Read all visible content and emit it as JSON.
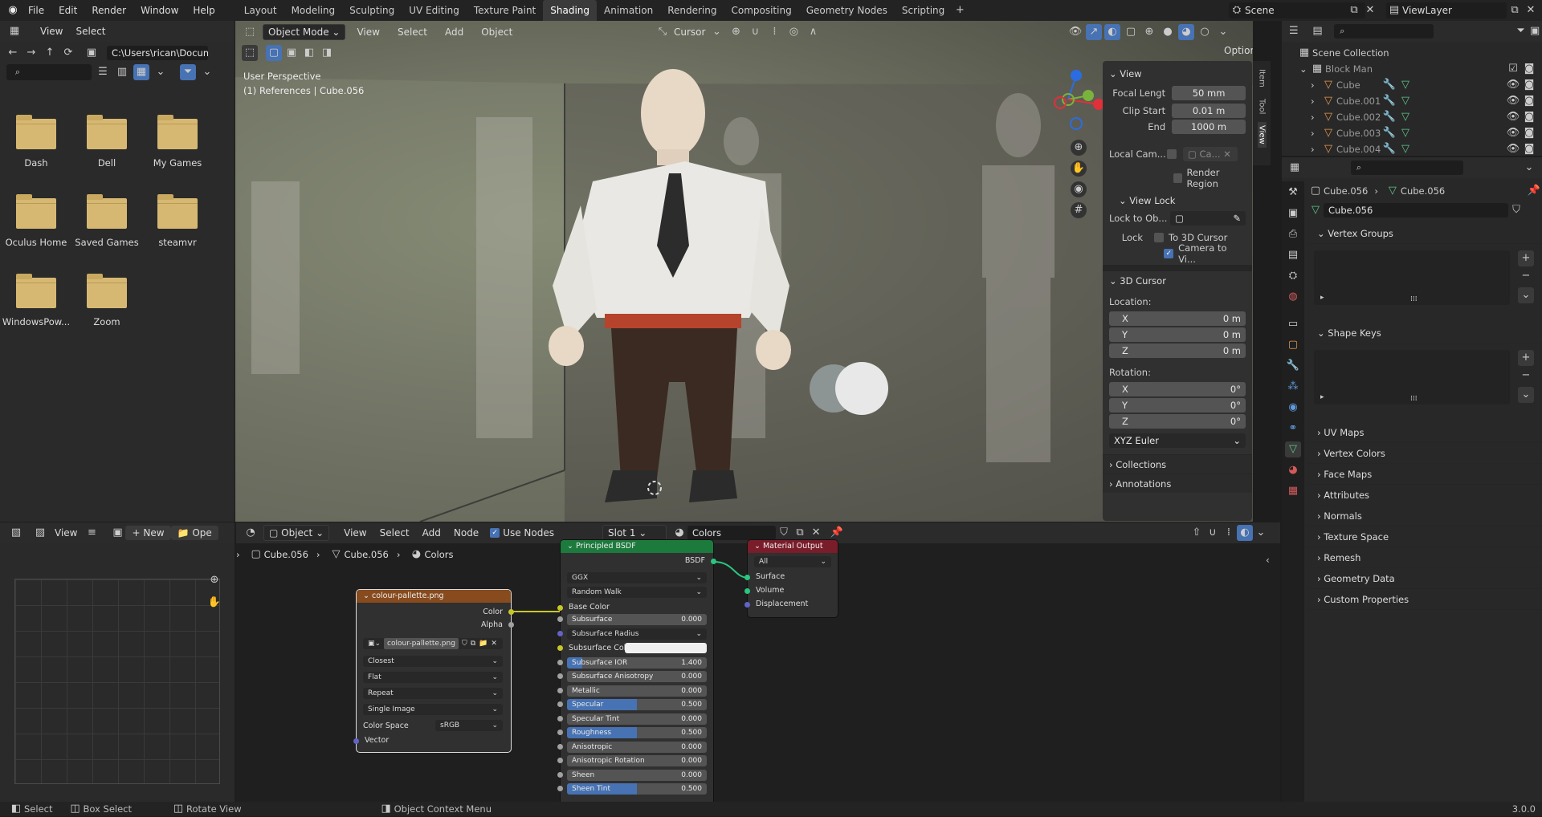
{
  "menubar": {
    "file": "File",
    "edit": "Edit",
    "render": "Render",
    "window": "Window",
    "help": "Help"
  },
  "workspaces": [
    "Layout",
    "Modeling",
    "Sculpting",
    "UV Editing",
    "Texture Paint",
    "Shading",
    "Animation",
    "Rendering",
    "Compositing",
    "Geometry Nodes",
    "Scripting"
  ],
  "scene": {
    "name": "Scene",
    "view_layer": "ViewLayer"
  },
  "file_browser": {
    "view": "View",
    "select": "Select",
    "path": "C:\\Users\\rican\\Docum...",
    "folders": [
      "Dash",
      "Dell",
      "My Games",
      "Oculus Home",
      "Saved Games",
      "steamvr",
      "WindowsPow...",
      "Zoom"
    ]
  },
  "viewport": {
    "mode": "Object Mode",
    "view": "View",
    "select": "Select",
    "add": "Add",
    "object": "Object",
    "pivot": "Cursor",
    "options": "Options",
    "perspective": "User Perspective",
    "collection_info": "(1) References | Cube.056"
  },
  "npanel": {
    "tabs": [
      "Item",
      "Tool",
      "View"
    ],
    "view_header": "View",
    "focal_label": "Focal Lengt",
    "focal": "50 mm",
    "clip_start_label": "Clip Start",
    "clip_start": "0.01 m",
    "end_label": "End",
    "end": "1000 m",
    "local_cam": "Local Cam...",
    "local_cam_val": "Ca...",
    "render_region": "Render Region",
    "view_lock": "View Lock",
    "lock_to_ob": "Lock to Ob...",
    "lock": "Lock",
    "to_3d_cursor": "To 3D Cursor",
    "camera_to_view": "Camera to Vi...",
    "cursor_header": "3D Cursor",
    "location": "Location:",
    "loc": [
      {
        "axis": "X",
        "val": "0 m"
      },
      {
        "axis": "Y",
        "val": "0 m"
      },
      {
        "axis": "Z",
        "val": "0 m"
      }
    ],
    "rotation": "Rotation:",
    "rot": [
      {
        "axis": "X",
        "val": "0°"
      },
      {
        "axis": "Y",
        "val": "0°"
      },
      {
        "axis": "Z",
        "val": "0°"
      }
    ],
    "rot_mode": "XYZ Euler",
    "collections": "Collections",
    "annotations": "Annotations"
  },
  "outliner": {
    "root": "Scene Collection",
    "collection": "Block Man",
    "objects": [
      "Cube",
      "Cube.001",
      "Cube.002",
      "Cube.003",
      "Cube.004"
    ]
  },
  "properties": {
    "breadcrumb_obj": "Cube.056",
    "breadcrumb_mesh": "Cube.056",
    "mesh_name": "Cube.056",
    "vertex_groups": "Vertex Groups",
    "shape_keys": "Shape Keys",
    "sections": [
      "UV Maps",
      "Vertex Colors",
      "Face Maps",
      "Attributes",
      "Normals",
      "Texture Space",
      "Remesh",
      "Geometry Data",
      "Custom Properties"
    ]
  },
  "image_editor": {
    "view": "View",
    "new": "New",
    "open": "Ope"
  },
  "node_editor": {
    "object": "Object",
    "view": "View",
    "select": "Select",
    "add": "Add",
    "node": "Node",
    "use_nodes": "Use Nodes",
    "slot": "Slot 1",
    "material": "Colors",
    "bc_obj": "Cube.056",
    "bc_mesh": "Cube.056",
    "bc_mat": "Colors"
  },
  "image_node": {
    "title": "colour-pallette.png",
    "color": "Color",
    "alpha": "Alpha",
    "image": "colour-pallette.png",
    "interp": "Closest",
    "proj": "Flat",
    "ext": "Repeat",
    "source": "Single Image",
    "cs_label": "Color Space",
    "cs": "sRGB",
    "vector": "Vector"
  },
  "bsdf_node": {
    "title": "Principled BSDF",
    "out": "BSDF",
    "dist": "GGX",
    "sss_method": "Random Walk",
    "base_color": "Base Color",
    "rows": [
      {
        "label": "Subsurface",
        "val": "0.000",
        "fill": 0
      },
      {
        "label": "Subsurface IOR",
        "val": "1.400",
        "fill": 0.11
      },
      {
        "label": "Subsurface Anisotropy",
        "val": "0.000",
        "fill": 0
      },
      {
        "label": "Metallic",
        "val": "0.000",
        "fill": 0
      },
      {
        "label": "Specular",
        "val": "0.500",
        "fill": 0.5
      },
      {
        "label": "Specular Tint",
        "val": "0.000",
        "fill": 0
      },
      {
        "label": "Roughness",
        "val": "0.500",
        "fill": 0.5
      },
      {
        "label": "Anisotropic",
        "val": "0.000",
        "fill": 0
      },
      {
        "label": "Anisotropic Rotation",
        "val": "0.000",
        "fill": 0
      },
      {
        "label": "Sheen",
        "val": "0.000",
        "fill": 0
      },
      {
        "label": "Sheen Tint",
        "val": "0.500",
        "fill": 0.5
      }
    ],
    "sss_radius": "Subsurface Radius",
    "sss_color": "Subsurface Colo"
  },
  "output_node": {
    "title": "Material Output",
    "target": "All",
    "surface": "Surface",
    "volume": "Volume",
    "displacement": "Displacement"
  },
  "statusbar": {
    "select": "Select",
    "box_select": "Box Select",
    "rotate": "Rotate View",
    "context": "Object Context Menu",
    "version": "3.0.0"
  }
}
